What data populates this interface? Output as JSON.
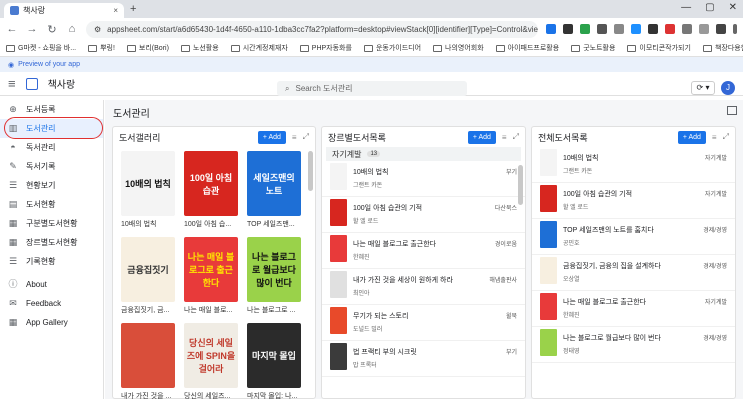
{
  "browser": {
    "tab_title": "책사랑",
    "tab_close": "×",
    "new_tab": "+",
    "window_controls": [
      "—",
      "▢",
      "✕"
    ],
    "url": "appsheet.com/start/a6d65430-1d4f-4650-a110-1dba3cc7fa2?platform=desktop#viewStack[0][identifier][Type]=Control&view...",
    "bookmarks": [
      "G마켓 - 쇼핑을 바...",
      "뿌링!",
      "보리(Bori)",
      "노선활용",
      "시간계정제재자",
      "PHP자동화를",
      "운동가이드디어",
      "나의영어회화",
      "아이패드프로활용",
      "굿노트활용",
      "이모티콘작가되기",
      "책장다용한",
      "모든 북마크"
    ]
  },
  "preview_banner": "Preview of your app",
  "app": {
    "name": "책사랑",
    "search_placeholder": "Search 도서관리",
    "user_initial": "J",
    "sync_label": "⟳ ▾"
  },
  "sidebar": {
    "items": [
      {
        "label": "도서등록",
        "icon": "plus-circle-icon"
      },
      {
        "label": "도서관리",
        "icon": "books-icon",
        "active": true
      },
      {
        "label": "독서관리",
        "icon": "reading-icon"
      },
      {
        "label": "독서기록",
        "icon": "pencil-icon"
      },
      {
        "label": "현황보기",
        "icon": "list-icon"
      },
      {
        "label": "도서현황",
        "icon": "chart-icon"
      },
      {
        "label": "구분별도서현황",
        "icon": "bar-chart-icon"
      },
      {
        "label": "장르별도서현황",
        "icon": "bar-chart-icon"
      },
      {
        "label": "기록현황",
        "icon": "list-icon"
      },
      {
        "label": "About",
        "icon": "info-icon"
      },
      {
        "label": "Feedback",
        "icon": "feedback-icon"
      },
      {
        "label": "App Gallery",
        "icon": "grid-icon"
      }
    ]
  },
  "main": {
    "title": "도서관리",
    "add_label": "+ Add",
    "gallery": {
      "title": "도서갤러리",
      "cards": [
        {
          "label": "10배의 법칙",
          "cover": "10배의 법칙",
          "color": "#f4f4f4",
          "text": "#111"
        },
        {
          "label": "100일 아침 습...",
          "cover": "100일 아침 습관",
          "color": "#d7261f",
          "text": "#fff"
        },
        {
          "label": "TOP 세일즈맨...",
          "cover": "세일즈맨의 노트",
          "color": "#1e6fd6",
          "text": "#fff"
        },
        {
          "label": "금융집짓기, 금...",
          "cover": "금융집짓기",
          "color": "#f7efe0",
          "text": "#333"
        },
        {
          "label": "나는 매일 블로...",
          "cover": "나는 매일 블로그로 출근한다",
          "color": "#e83a3a",
          "text": "#ffe600"
        },
        {
          "label": "나는 블로그로 ...",
          "cover": "나는 블로그로 월급보다 많이 번다",
          "color": "#9ad24a",
          "text": "#111"
        },
        {
          "label": "내가 가진 것을 ...",
          "cover": "",
          "color": "#d94e3a",
          "text": "#fff"
        },
        {
          "label": "당신의 세일즈...",
          "cover": "당신의 세일즈에 SPIN을 걸어라",
          "color": "#f0ece4",
          "text": "#c0392b"
        },
        {
          "label": "마지막 몰입: 나...",
          "cover": "마지막 몰입",
          "color": "#2b2b2b",
          "text": "#fff"
        }
      ]
    },
    "genre": {
      "title": "장르별도서목록",
      "group_name": "자기계발",
      "group_count": "13",
      "rows": [
        {
          "title": "10배의 법칙",
          "author": "그랜트 카돈",
          "category": "부기",
          "color": "#f4f4f4"
        },
        {
          "title": "100일 아침 습관의 기적",
          "author": "할 엘 로드",
          "category": "다산북스",
          "color": "#d7261f"
        },
        {
          "title": "나는 매일 블로그로 출근한다",
          "author": "한혜진",
          "category": "경이로움",
          "color": "#e83a3a"
        },
        {
          "title": "내가 가진 것을 세상이 원하게 하라",
          "author": "최인아",
          "category": "해냄출판사",
          "color": "#e0e0e0"
        },
        {
          "title": "무기가 되는 스토리",
          "author": "도널드 밀러",
          "category": "윌북",
          "color": "#e84a2a"
        },
        {
          "title": "법 프랙티 부의 시크릿",
          "author": "밥 프록터",
          "category": "부기",
          "color": "#3b3b3b"
        }
      ]
    },
    "all": {
      "title": "전체도서목록",
      "rows": [
        {
          "title": "10배의 법칙",
          "author": "그랜트 카돈",
          "category": "자기계발",
          "color": "#f4f4f4"
        },
        {
          "title": "100일 아침 습관의 기적",
          "author": "할 엘 로드",
          "category": "자기계발",
          "color": "#d7261f"
        },
        {
          "title": "TOP 세일즈맨의 노트를 훔치다",
          "author": "공민호",
          "category": "경제/경영",
          "color": "#1e6fd6"
        },
        {
          "title": "금융집짓기, 금융의 집을 설계하다",
          "author": "오상열",
          "category": "경제/경영",
          "color": "#f7efe0"
        },
        {
          "title": "나는 매일 블로그로 출근한다",
          "author": "한혜진",
          "category": "자기계발",
          "color": "#e83a3a"
        },
        {
          "title": "나는 블로그로 월급보다 많이 번다",
          "author": "정태영",
          "category": "경제/경영",
          "color": "#9ad24a"
        }
      ]
    }
  }
}
